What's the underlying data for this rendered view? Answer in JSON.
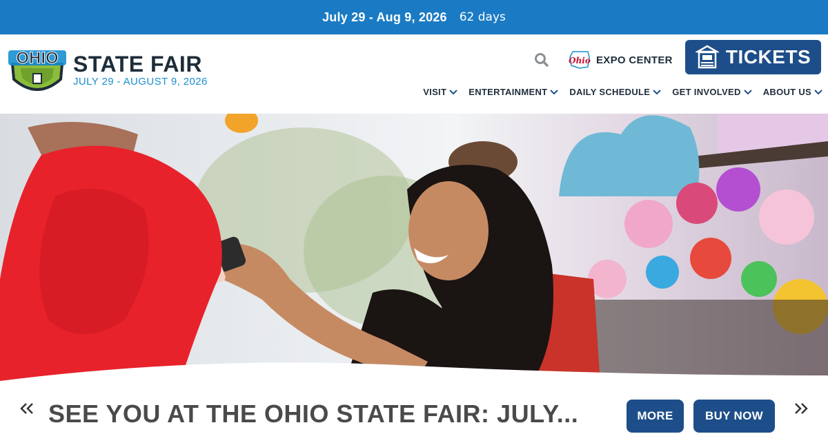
{
  "topbar": {
    "dates": "July 29 - Aug 9, 2026",
    "countdown": "62 days"
  },
  "logo": {
    "mark_text": "OHIO",
    "title": "STATE FAIR",
    "subtitle": "JULY 29 - AUGUST 9, 2026"
  },
  "header": {
    "search_icon": "search-icon",
    "expo": {
      "brand": "Ohio",
      "label": "EXPO CENTER"
    },
    "tickets": {
      "label": "TICKETS",
      "icon": "ticket-booth-icon"
    }
  },
  "nav": [
    {
      "label": "VISIT"
    },
    {
      "label": "ENTERTAINMENT"
    },
    {
      "label": "DAILY SCHEDULE"
    },
    {
      "label": "GET INVOLVED"
    },
    {
      "label": "ABOUT US"
    }
  ],
  "hero": {
    "description_icon": "hero-photo"
  },
  "carousel": {
    "prev_icon": "double-chevron-left-icon",
    "next_icon": "double-chevron-right-icon",
    "headline": "SEE YOU AT THE OHIO STATE FAIR: JULY...",
    "more_label": "MORE",
    "buy_label": "BUY NOW"
  },
  "colors": {
    "topbar": "#1a7bc4",
    "brand_navy": "#1d4e89",
    "logo_green": "#8bbd3c",
    "subtitle_blue": "#1a8fd0",
    "text_dark": "#1e2d3a",
    "headline_gray": "#4a4a4a"
  }
}
